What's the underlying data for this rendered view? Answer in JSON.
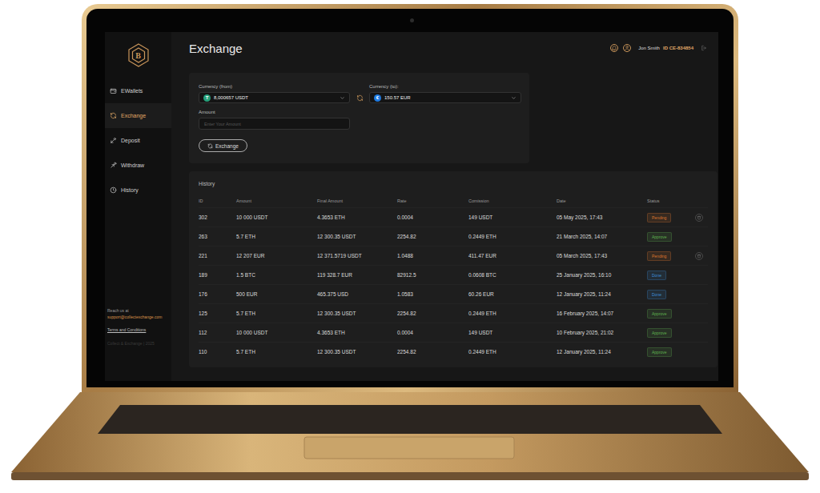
{
  "sidebar": {
    "logo": "B",
    "items": [
      {
        "label": "EWallets",
        "selected": false
      },
      {
        "label": "Exchange",
        "selected": true
      },
      {
        "label": "Deposit",
        "selected": false
      },
      {
        "label": "Withdraw",
        "selected": false
      },
      {
        "label": "History",
        "selected": false
      }
    ],
    "footer": {
      "contact_label": "Reach us at",
      "email": "support@collectexchange.com",
      "terms": "Terms and Conditions",
      "copyright": "Collect & Exchange | 2025"
    }
  },
  "header": {
    "title": "Exchange",
    "user_name": "Jon Smith",
    "user_id": "ID CE-834854"
  },
  "form": {
    "from_label": "Currency (from)",
    "from": {
      "icon": "T",
      "value": "8,000657 USDT",
      "color": "#26a17b"
    },
    "to_label": "Currency (to):",
    "to": {
      "icon": "€",
      "value": "150.57 EUR",
      "color": "#1f7ae0"
    },
    "amount_label": "Amount",
    "amount_placeholder": "Enter Your Amount",
    "button": "Exchange"
  },
  "history": {
    "title": "History",
    "columns": [
      "ID",
      "Amount",
      "Final Amount",
      "Rate",
      "Comission",
      "Date",
      "Status"
    ],
    "rows": [
      {
        "cells": [
          "302",
          "10 000 USDT",
          "4.3653 ETH",
          "0.0004",
          "149 USDT",
          "05 May 2025, 17:43"
        ],
        "status": "Pending",
        "color": "#d8762f",
        "deletable": true
      },
      {
        "cells": [
          "263",
          "5.7 ETH",
          "12 300.35 USDT",
          "2254.82",
          "0.2449 ETH",
          "21 March 2025, 14:07"
        ],
        "status": "Approve",
        "color": "#5fae4f",
        "deletable": false
      },
      {
        "cells": [
          "221",
          "12 207 EUR",
          "12 371.5719 USDT",
          "1.0488",
          "411.47 EUR",
          "05 March 2025, 17:43"
        ],
        "status": "Pending",
        "color": "#d8762f",
        "deletable": true
      },
      {
        "cells": [
          "189",
          "1.5 BTC",
          "119 328.7 EUR",
          "82912.5",
          "0.0608 BTC",
          "25 January 2025, 16:10"
        ],
        "status": "Done",
        "color": "#3f8fd6",
        "deletable": false
      },
      {
        "cells": [
          "176",
          "500 EUR",
          "465.375 USD",
          "1.0583",
          "60.26 EUR",
          "12 January 2025, 11:24"
        ],
        "status": "Done",
        "color": "#3f8fd6",
        "deletable": false
      },
      {
        "cells": [
          "125",
          "5.7 ETH",
          "12 300.35 USDT",
          "2254.82",
          "0.2449 ETH",
          "16 February 2025, 14:07"
        ],
        "status": "Approve",
        "color": "#5fae4f",
        "deletable": false
      },
      {
        "cells": [
          "112",
          "10 000 USDT",
          "4.3653 ETH",
          "0.0004",
          "149 USDT",
          "10 February 2025, 21:02"
        ],
        "status": "Approve",
        "color": "#5fae4f",
        "deletable": false
      },
      {
        "cells": [
          "110",
          "5.7 ETH",
          "12 300.35 USDT",
          "2254.82",
          "0.2449 ETH",
          "12 January 2025, 11:24"
        ],
        "status": "Approve",
        "color": "#5fae4f",
        "deletable": false
      }
    ]
  }
}
